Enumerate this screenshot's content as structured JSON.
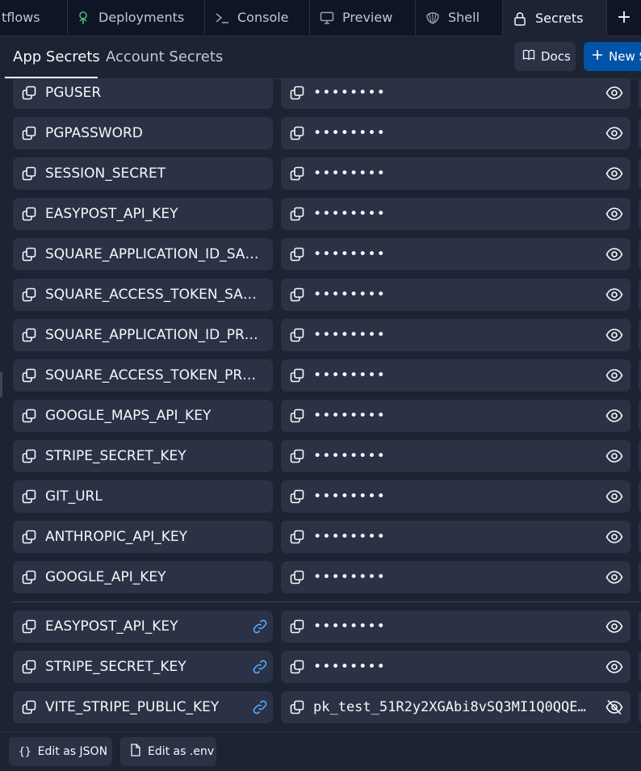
{
  "tabs": [
    {
      "label": "tflows",
      "icon": "none"
    },
    {
      "label": "Deployments",
      "icon": "deployments-icon"
    },
    {
      "label": "Console",
      "icon": "terminal-icon"
    },
    {
      "label": "Preview",
      "icon": "monitor-icon"
    },
    {
      "label": "Shell",
      "icon": "shell-icon"
    },
    {
      "label": "Secrets",
      "icon": "lock-icon",
      "active": true
    }
  ],
  "add_tab_label": "+",
  "subtabs": [
    {
      "label": "App Secrets",
      "active": true
    },
    {
      "label": "Account Secrets"
    }
  ],
  "header_buttons": {
    "docs_label": "Docs",
    "new_label": "New S"
  },
  "masked_value": "••••••••",
  "app_secrets": [
    {
      "key": "PGUSER"
    },
    {
      "key": "PGPASSWORD"
    },
    {
      "key": "SESSION_SECRET"
    },
    {
      "key": "EASYPOST_API_KEY"
    },
    {
      "key": "SQUARE_APPLICATION_ID_SANDBOX"
    },
    {
      "key": "SQUARE_ACCESS_TOKEN_SANDBOX"
    },
    {
      "key": "SQUARE_APPLICATION_ID_PRODUCTION"
    },
    {
      "key": "SQUARE_ACCESS_TOKEN_PRODUCTION"
    },
    {
      "key": "GOOGLE_MAPS_API_KEY"
    },
    {
      "key": "STRIPE_SECRET_KEY"
    },
    {
      "key": "GIT_URL"
    },
    {
      "key": "ANTHROPIC_API_KEY"
    },
    {
      "key": "GOOGLE_API_KEY"
    }
  ],
  "linked_secrets": [
    {
      "key": "EASYPOST_API_KEY",
      "value": "••••••••",
      "revealed": false
    },
    {
      "key": "STRIPE_SECRET_KEY",
      "value": "••••••••",
      "revealed": false
    },
    {
      "key": "VITE_STRIPE_PUBLIC_KEY",
      "value": "pk_test_51R2y2XGAbi8vSQ3MI1Q0QQE…",
      "revealed": true
    }
  ],
  "footer": {
    "edit_json_label": "Edit as JSON",
    "edit_env_label": "Edit as .env"
  },
  "colors": {
    "background": "#1c2333",
    "surface": "#2b3245",
    "tabbar": "#0e1525",
    "primary": "#0053a6",
    "link": "#57abff",
    "text": "#f5f9fc"
  }
}
